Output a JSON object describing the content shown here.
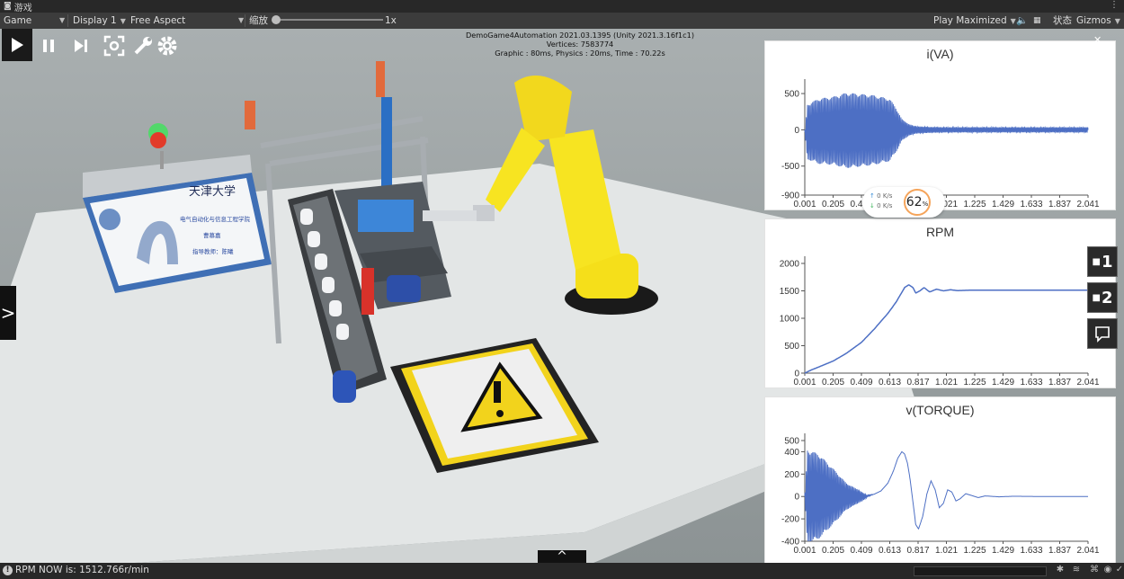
{
  "window": {
    "tab_icon": "gamepad-icon",
    "tab_label": "游戏",
    "menu_icon": "kebab-icon",
    "menu_label": "⋮"
  },
  "toolbar": {
    "view_mode": "Game",
    "display": "Display 1",
    "aspect": "Free Aspect",
    "scale_label": "缩放",
    "scale_value": "1x",
    "play_mode": "Play Maximized",
    "mute_icon": "speaker-icon",
    "stats_icon": "keyboard-icon",
    "stats_label": "状态",
    "gizmos": "Gizmos"
  },
  "game_controls": {
    "play_icon": "play-icon",
    "pause_icon": "pause-icon",
    "step_icon": "step-icon",
    "focus_icon": "focus-frame-icon",
    "tools_icon": "wrench-icon",
    "settings_icon": "gear-icon"
  },
  "stats": {
    "line1": "DemoGame4Automation 2021.03.1395 (Unity 2021.3.16f1c1)",
    "line2": "Vertices: 7583774",
    "line3": "Graphic : 80ms, Physics : 20ms, Time : 70.22s"
  },
  "scene": {
    "poster_title": "天津大学",
    "poster_line1": "电气自动化与信息工程学院",
    "poster_line2": "曹慕嘉",
    "poster_line3": "指导教师：陈曦"
  },
  "side_buttons": {
    "cam1": "1",
    "cam2": "2",
    "cam1_icon": "camera-icon",
    "cam2_icon": "camera-icon",
    "chat_icon": "comment-icon"
  },
  "monitor": {
    "up_value": "0",
    "down_value": "0",
    "unit": "K/s",
    "up_icon": "arrow-up-icon",
    "down_icon": "arrow-down-icon",
    "percent": "62",
    "percent_sign": "%"
  },
  "nav": {
    "left_toggle": ">",
    "bottom_toggle": "^"
  },
  "status_bar": {
    "info_icon": "info-icon",
    "message": "RPM NOW is: 1512.766r/min",
    "icons": [
      "bug-icon",
      "layers-icon",
      "network-icon",
      "eye-icon",
      "check-icon"
    ]
  },
  "colors": {
    "series": "#4d6fc4",
    "panel_bg": "#ffffff",
    "toolbar": "#3c3c3c",
    "viewport": "#9da4a5"
  },
  "chart_data": [
    {
      "type": "line",
      "title": "i(VA)",
      "x_ticks": [
        "0.001",
        "0.205",
        "0.409",
        "0.613",
        "0.817",
        "1.021",
        "1.225",
        "1.429",
        "1.633",
        "1.837",
        "2.041"
      ],
      "ylim": [
        -900,
        600
      ],
      "y_ticks": [
        "500",
        "0",
        "-500",
        "-900"
      ],
      "y_tick_values": [
        500,
        0,
        -500,
        -900
      ],
      "grid": false,
      "series": [
        {
          "name": "",
          "envelope": [
            [
              0.001,
              0
            ],
            [
              0.02,
              380
            ],
            [
              0.1,
              450
            ],
            [
              0.205,
              470
            ],
            [
              0.3,
              520
            ],
            [
              0.409,
              500
            ],
            [
              0.5,
              480
            ],
            [
              0.613,
              430
            ],
            [
              0.66,
              300
            ],
            [
              0.7,
              150
            ],
            [
              0.75,
              80
            ],
            [
              0.8,
              50
            ],
            [
              0.9,
              40
            ],
            [
              1.021,
              35
            ],
            [
              1.5,
              35
            ],
            [
              2.041,
              35
            ]
          ],
          "oscillation_hz": 110
        }
      ]
    },
    {
      "type": "line",
      "title": "RPM",
      "x_ticks": [
        "0.001",
        "0.205",
        "0.409",
        "0.613",
        "0.817",
        "1.021",
        "1.225",
        "1.429",
        "1.633",
        "1.837",
        "2.041"
      ],
      "ylim": [
        0,
        2000
      ],
      "y_ticks": [
        "2000",
        "1500",
        "1000",
        "500",
        "0"
      ],
      "y_tick_values": [
        2000,
        1500,
        1000,
        500,
        0
      ],
      "grid": false,
      "series": [
        {
          "name": "",
          "points": [
            [
              0.001,
              0
            ],
            [
              0.05,
              60
            ],
            [
              0.1,
              110
            ],
            [
              0.205,
              220
            ],
            [
              0.3,
              360
            ],
            [
              0.409,
              560
            ],
            [
              0.5,
              800
            ],
            [
              0.6,
              1090
            ],
            [
              0.66,
              1300
            ],
            [
              0.72,
              1560
            ],
            [
              0.75,
              1610
            ],
            [
              0.78,
              1560
            ],
            [
              0.8,
              1460
            ],
            [
              0.83,
              1500
            ],
            [
              0.86,
              1560
            ],
            [
              0.9,
              1480
            ],
            [
              0.95,
              1530
            ],
            [
              1.0,
              1500
            ],
            [
              1.05,
              1520
            ],
            [
              1.1,
              1505
            ],
            [
              1.2,
              1512
            ],
            [
              1.5,
              1512
            ],
            [
              2.041,
              1512
            ]
          ]
        }
      ]
    },
    {
      "type": "line",
      "title": "v(TORQUE)",
      "x_ticks": [
        "0.001",
        "0.205",
        "0.409",
        "0.613",
        "0.817",
        "1.021",
        "1.225",
        "1.429",
        "1.633",
        "1.837",
        "2.041"
      ],
      "ylim": [
        -400,
        500
      ],
      "y_ticks": [
        "500",
        "400",
        "200",
        "0",
        "-200",
        "-400"
      ],
      "y_tick_values": [
        500,
        400,
        200,
        0,
        -200,
        -400
      ],
      "grid": false,
      "series": [
        {
          "name": "",
          "envelope": [
            [
              0.001,
              0
            ],
            [
              0.02,
              420
            ],
            [
              0.1,
              380
            ],
            [
              0.205,
              250
            ],
            [
              0.3,
              120
            ],
            [
              0.4,
              50
            ],
            [
              0.45,
              10
            ],
            [
              0.5,
              0
            ],
            [
              2.041,
              0
            ]
          ],
          "oscillation_hz": 110,
          "smooth_points": [
            [
              0.45,
              5
            ],
            [
              0.5,
              20
            ],
            [
              0.55,
              50
            ],
            [
              0.6,
              120
            ],
            [
              0.64,
              230
            ],
            [
              0.67,
              340
            ],
            [
              0.7,
              400
            ],
            [
              0.72,
              380
            ],
            [
              0.74,
              300
            ],
            [
              0.76,
              150
            ],
            [
              0.78,
              -50
            ],
            [
              0.8,
              -250
            ],
            [
              0.82,
              -290
            ],
            [
              0.85,
              -180
            ],
            [
              0.88,
              20
            ],
            [
              0.91,
              140
            ],
            [
              0.94,
              60
            ],
            [
              0.97,
              -100
            ],
            [
              1.0,
              -60
            ],
            [
              1.03,
              60
            ],
            [
              1.06,
              40
            ],
            [
              1.09,
              -40
            ],
            [
              1.12,
              -20
            ],
            [
              1.16,
              25
            ],
            [
              1.2,
              10
            ],
            [
              1.25,
              -10
            ],
            [
              1.3,
              5
            ],
            [
              1.4,
              -3
            ],
            [
              1.5,
              2
            ],
            [
              1.7,
              0
            ],
            [
              2.041,
              0
            ]
          ]
        }
      ]
    }
  ]
}
